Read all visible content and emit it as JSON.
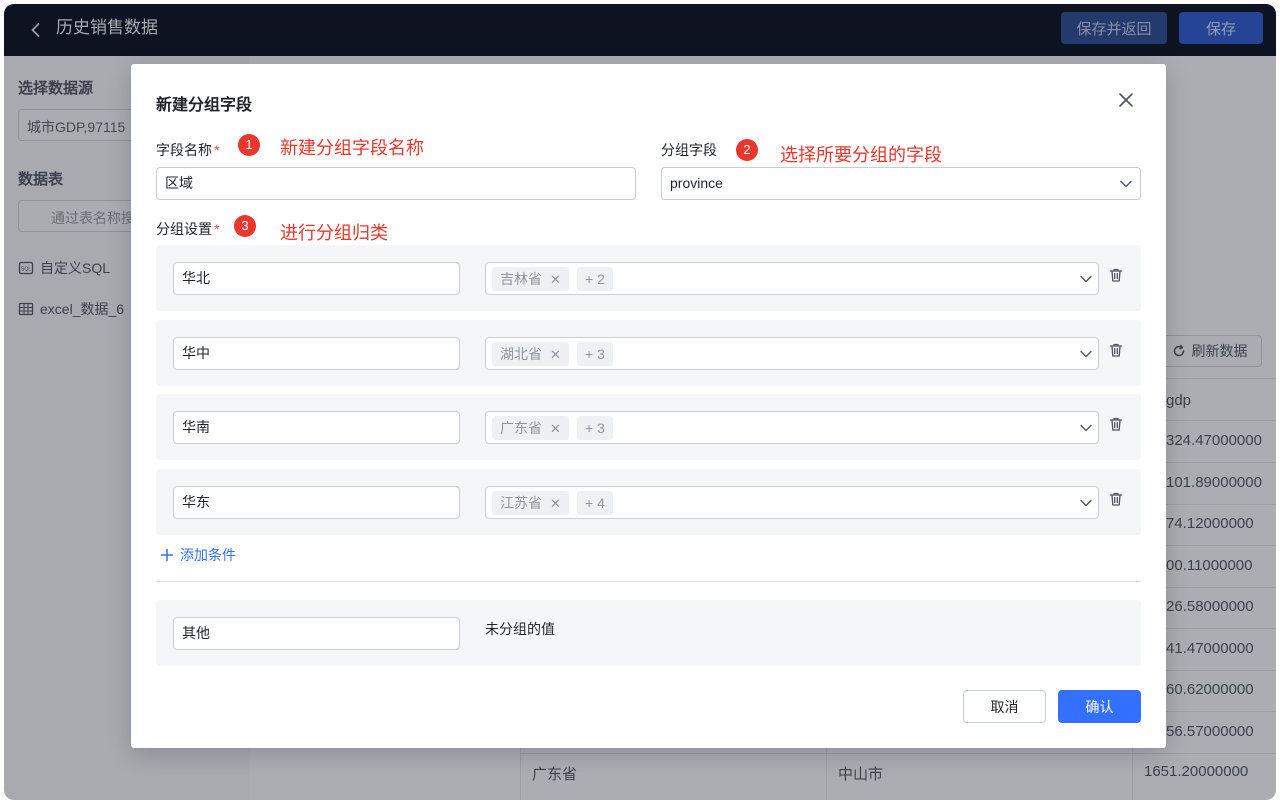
{
  "topbar": {
    "title": "历史销售数据",
    "save_return_label": "保存并返回",
    "save_label": "保存"
  },
  "background": {
    "datasource_label": "选择数据源",
    "datasource_value": "城市GDP,97115",
    "tables_label": "数据表",
    "search_placeholder": "通过表名称搜",
    "items": [
      "自定义SQL",
      "excel_数据_6"
    ],
    "refresh_label": "刷新数据",
    "column_header": "gdp",
    "gdp_values": [
      "324.47000000",
      "101.89000000",
      "74.12000000",
      "00.11000000",
      "26.58000000",
      "41.47000000",
      "60.62000000",
      "56.57000000"
    ],
    "last_row": {
      "province": "广东省",
      "city": "中山市",
      "gdp": "1651.20000000"
    }
  },
  "modal": {
    "title": "新建分组字段",
    "field_name_label": "字段名称",
    "required_mark": "*",
    "field_name_value": "区域",
    "group_field_label": "分组字段",
    "group_field_value": "province",
    "group_settings_label": "分组设置",
    "annotations": [
      {
        "num": "1",
        "text": "新建分组字段名称"
      },
      {
        "num": "2",
        "text": "选择所要分组的字段"
      },
      {
        "num": "3",
        "text": "进行分组归类"
      }
    ],
    "groups": [
      {
        "name": "华北",
        "tag": "吉林省",
        "more": "+ 2"
      },
      {
        "name": "华中",
        "tag": "湖北省",
        "more": "+ 3"
      },
      {
        "name": "华南",
        "tag": "广东省",
        "more": "+ 3"
      },
      {
        "name": "华东",
        "tag": "江苏省",
        "more": "+ 4"
      }
    ],
    "add_condition_label": "添加条件",
    "other_name": "其他",
    "other_note": "未分组的值",
    "cancel_label": "取消",
    "confirm_label": "确认"
  }
}
